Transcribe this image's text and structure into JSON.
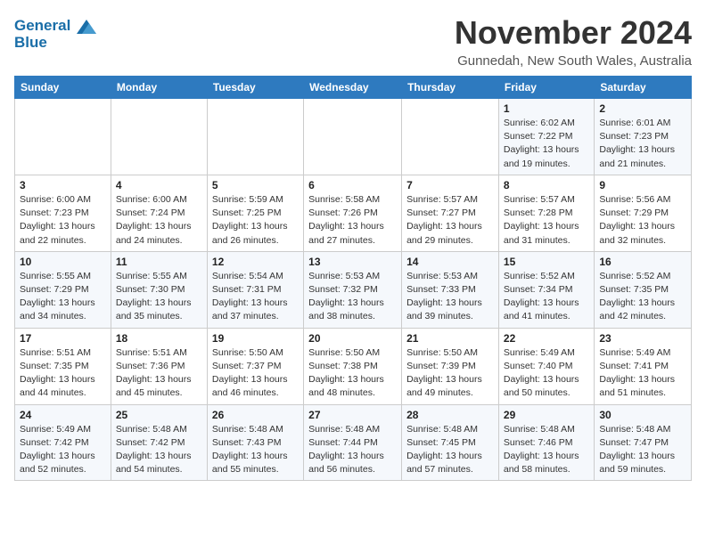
{
  "header": {
    "logo_line1": "General",
    "logo_line2": "Blue",
    "month_year": "November 2024",
    "location": "Gunnedah, New South Wales, Australia"
  },
  "weekdays": [
    "Sunday",
    "Monday",
    "Tuesday",
    "Wednesday",
    "Thursday",
    "Friday",
    "Saturday"
  ],
  "weeks": [
    [
      {
        "day": "",
        "info": ""
      },
      {
        "day": "",
        "info": ""
      },
      {
        "day": "",
        "info": ""
      },
      {
        "day": "",
        "info": ""
      },
      {
        "day": "",
        "info": ""
      },
      {
        "day": "1",
        "info": "Sunrise: 6:02 AM\nSunset: 7:22 PM\nDaylight: 13 hours\nand 19 minutes."
      },
      {
        "day": "2",
        "info": "Sunrise: 6:01 AM\nSunset: 7:23 PM\nDaylight: 13 hours\nand 21 minutes."
      }
    ],
    [
      {
        "day": "3",
        "info": "Sunrise: 6:00 AM\nSunset: 7:23 PM\nDaylight: 13 hours\nand 22 minutes."
      },
      {
        "day": "4",
        "info": "Sunrise: 6:00 AM\nSunset: 7:24 PM\nDaylight: 13 hours\nand 24 minutes."
      },
      {
        "day": "5",
        "info": "Sunrise: 5:59 AM\nSunset: 7:25 PM\nDaylight: 13 hours\nand 26 minutes."
      },
      {
        "day": "6",
        "info": "Sunrise: 5:58 AM\nSunset: 7:26 PM\nDaylight: 13 hours\nand 27 minutes."
      },
      {
        "day": "7",
        "info": "Sunrise: 5:57 AM\nSunset: 7:27 PM\nDaylight: 13 hours\nand 29 minutes."
      },
      {
        "day": "8",
        "info": "Sunrise: 5:57 AM\nSunset: 7:28 PM\nDaylight: 13 hours\nand 31 minutes."
      },
      {
        "day": "9",
        "info": "Sunrise: 5:56 AM\nSunset: 7:29 PM\nDaylight: 13 hours\nand 32 minutes."
      }
    ],
    [
      {
        "day": "10",
        "info": "Sunrise: 5:55 AM\nSunset: 7:29 PM\nDaylight: 13 hours\nand 34 minutes."
      },
      {
        "day": "11",
        "info": "Sunrise: 5:55 AM\nSunset: 7:30 PM\nDaylight: 13 hours\nand 35 minutes."
      },
      {
        "day": "12",
        "info": "Sunrise: 5:54 AM\nSunset: 7:31 PM\nDaylight: 13 hours\nand 37 minutes."
      },
      {
        "day": "13",
        "info": "Sunrise: 5:53 AM\nSunset: 7:32 PM\nDaylight: 13 hours\nand 38 minutes."
      },
      {
        "day": "14",
        "info": "Sunrise: 5:53 AM\nSunset: 7:33 PM\nDaylight: 13 hours\nand 39 minutes."
      },
      {
        "day": "15",
        "info": "Sunrise: 5:52 AM\nSunset: 7:34 PM\nDaylight: 13 hours\nand 41 minutes."
      },
      {
        "day": "16",
        "info": "Sunrise: 5:52 AM\nSunset: 7:35 PM\nDaylight: 13 hours\nand 42 minutes."
      }
    ],
    [
      {
        "day": "17",
        "info": "Sunrise: 5:51 AM\nSunset: 7:35 PM\nDaylight: 13 hours\nand 44 minutes."
      },
      {
        "day": "18",
        "info": "Sunrise: 5:51 AM\nSunset: 7:36 PM\nDaylight: 13 hours\nand 45 minutes."
      },
      {
        "day": "19",
        "info": "Sunrise: 5:50 AM\nSunset: 7:37 PM\nDaylight: 13 hours\nand 46 minutes."
      },
      {
        "day": "20",
        "info": "Sunrise: 5:50 AM\nSunset: 7:38 PM\nDaylight: 13 hours\nand 48 minutes."
      },
      {
        "day": "21",
        "info": "Sunrise: 5:50 AM\nSunset: 7:39 PM\nDaylight: 13 hours\nand 49 minutes."
      },
      {
        "day": "22",
        "info": "Sunrise: 5:49 AM\nSunset: 7:40 PM\nDaylight: 13 hours\nand 50 minutes."
      },
      {
        "day": "23",
        "info": "Sunrise: 5:49 AM\nSunset: 7:41 PM\nDaylight: 13 hours\nand 51 minutes."
      }
    ],
    [
      {
        "day": "24",
        "info": "Sunrise: 5:49 AM\nSunset: 7:42 PM\nDaylight: 13 hours\nand 52 minutes."
      },
      {
        "day": "25",
        "info": "Sunrise: 5:48 AM\nSunset: 7:42 PM\nDaylight: 13 hours\nand 54 minutes."
      },
      {
        "day": "26",
        "info": "Sunrise: 5:48 AM\nSunset: 7:43 PM\nDaylight: 13 hours\nand 55 minutes."
      },
      {
        "day": "27",
        "info": "Sunrise: 5:48 AM\nSunset: 7:44 PM\nDaylight: 13 hours\nand 56 minutes."
      },
      {
        "day": "28",
        "info": "Sunrise: 5:48 AM\nSunset: 7:45 PM\nDaylight: 13 hours\nand 57 minutes."
      },
      {
        "day": "29",
        "info": "Sunrise: 5:48 AM\nSunset: 7:46 PM\nDaylight: 13 hours\nand 58 minutes."
      },
      {
        "day": "30",
        "info": "Sunrise: 5:48 AM\nSunset: 7:47 PM\nDaylight: 13 hours\nand 59 minutes."
      }
    ]
  ]
}
